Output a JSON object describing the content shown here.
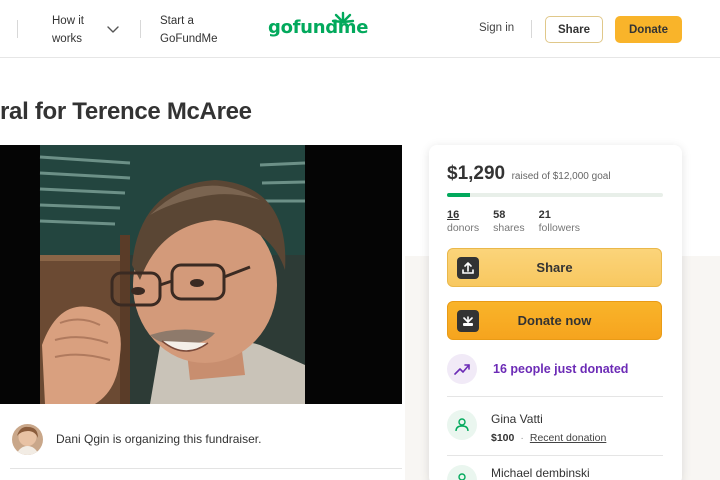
{
  "header": {
    "how_it_works": "How it works",
    "start": "Start a GoFundMe",
    "logo_text": "gofundme",
    "sign_in": "Sign in",
    "share": "Share",
    "donate": "Donate"
  },
  "campaign": {
    "title": "ral for Terence McAree",
    "organizer_text": "Dani Qgin is organizing this fundraiser."
  },
  "card": {
    "amount": "$1,290",
    "goal_text": "raised of $12,000 goal",
    "progress_fraction": 0.1075,
    "stats": [
      {
        "num": "16",
        "label": "donors"
      },
      {
        "num": "58",
        "label": "shares"
      },
      {
        "num": "21",
        "label": "followers"
      }
    ],
    "share_label": "Share",
    "donate_label": "Donate now",
    "trend_text": "16 people just donated",
    "donors": [
      {
        "name": "Gina Vatti",
        "amount": "$100",
        "note": "Recent donation"
      },
      {
        "name": "Michael dembinski"
      }
    ]
  },
  "colors": {
    "brand_green": "#02a95c",
    "donate_orange": "#f9b42a",
    "trend_purple": "#6c2bb6"
  }
}
